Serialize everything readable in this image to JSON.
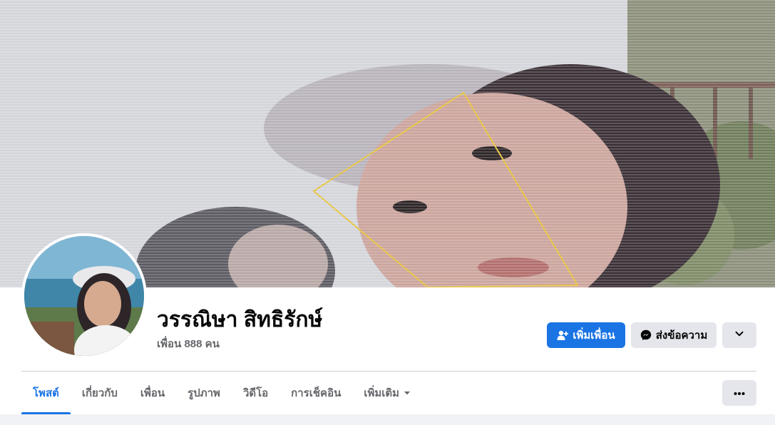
{
  "profile": {
    "name": "วรรณิษา สิทธิรักษ์",
    "friends_count": "เพื่อน 888 คน"
  },
  "actions": {
    "add_friend_label": "เพิ่มเพื่อน",
    "message_label": "ส่งข้อความ",
    "more_icon": "chevron-down-icon"
  },
  "tabs": [
    {
      "label": "โพสต์",
      "active": true
    },
    {
      "label": "เกี่ยวกับ",
      "active": false
    },
    {
      "label": "เพื่อน",
      "active": false
    },
    {
      "label": "รูปภาพ",
      "active": false
    },
    {
      "label": "วิดีโอ",
      "active": false
    },
    {
      "label": "การเช็คอิน",
      "active": false
    },
    {
      "label": "เพิ่มเติม",
      "active": false
    }
  ],
  "colors": {
    "accent": "#1b74e4",
    "secondary_button": "#e4e6eb",
    "muted_text": "#65676b"
  }
}
